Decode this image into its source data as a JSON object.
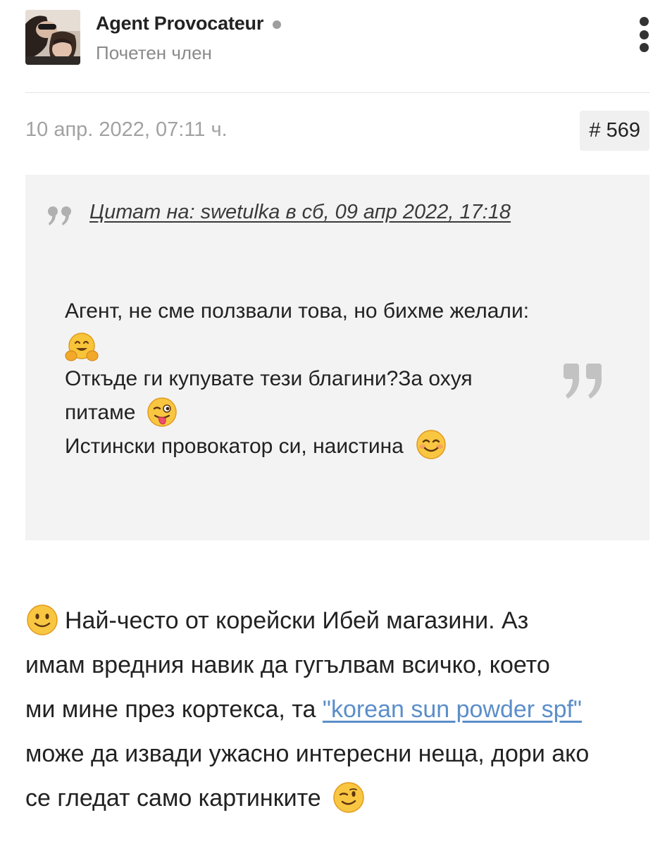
{
  "user": {
    "name": "Agent Provocateur",
    "role": "Почетен член",
    "status_color": "#9e9e9e"
  },
  "post": {
    "date": "10 апр. 2022, 07:11 ч.",
    "number": "# 569"
  },
  "quote": {
    "source": "Цитат на: swetulka в сб, 09 апр 2022, 17:18",
    "lines": [
      "Агент, не сме ползвали това, но бихме желали:",
      "Откъде ги купувате тези благини?За охуя",
      "питаме",
      "Истински провокатор си, наистина"
    ],
    "emojis": [
      "hugging-face-emoji",
      "winking-tongue-emoji",
      "smiling-blush-emoji"
    ]
  },
  "reply": {
    "line_1": "Най-често от корейски Ибей магазини. Аз",
    "line_2": "имам вредния навик да гугълвам всичко, което",
    "line_3_prefix": "ми мине през кортекса, та ",
    "link_text": "\"korean sun powder spf\"",
    "line_4": "може да извади ужасно интересни неща, дори ако",
    "line_5": "се гледат само картинките",
    "emojis": [
      "slight-smile-emoji",
      "wink-emoji"
    ]
  },
  "colors": {
    "link": "#5b8ec9",
    "quote_background": "#f3f3f3",
    "muted_text": "#a2a2a2",
    "badge_background": "#f0f0f0"
  }
}
